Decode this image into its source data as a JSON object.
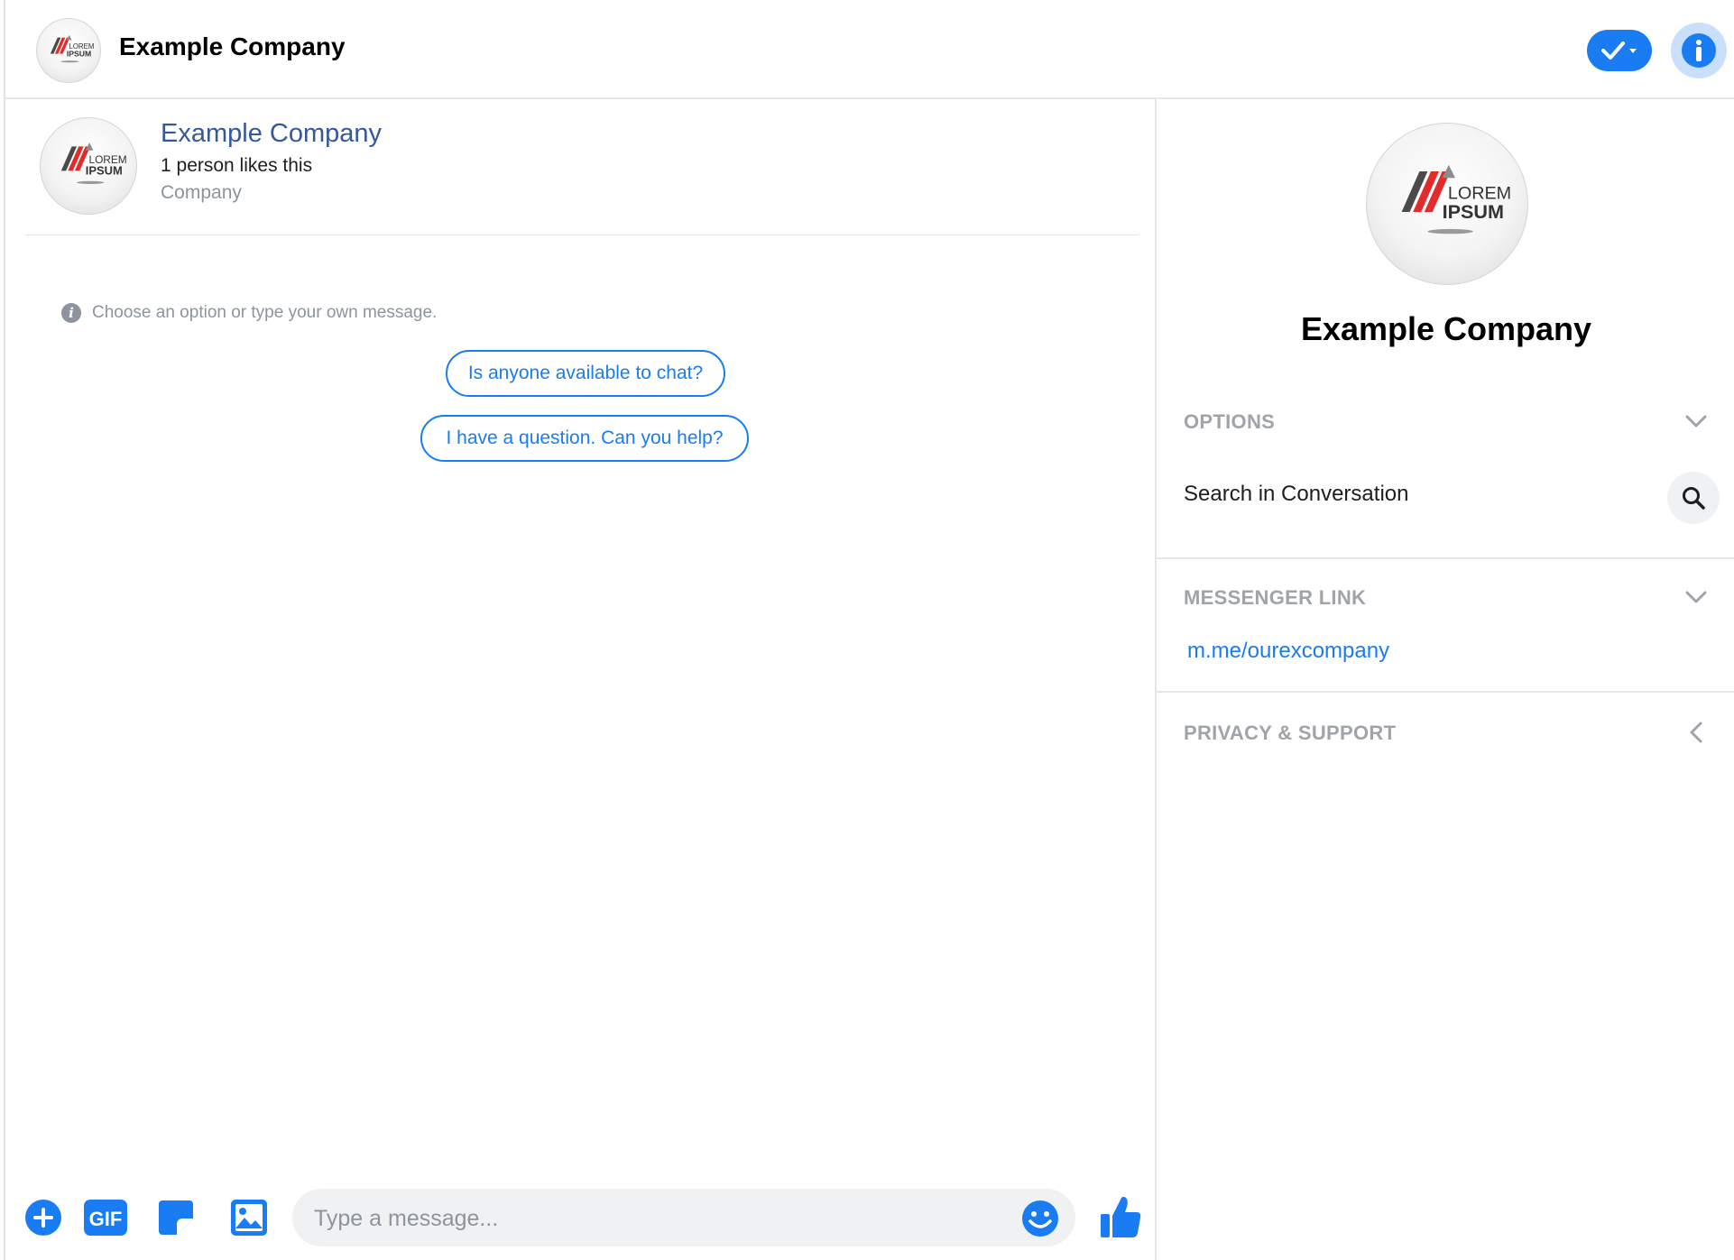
{
  "header": {
    "title": "Example Company"
  },
  "logo": {
    "line1": "LOREM",
    "line2": "IPSUM",
    "colors": {
      "dark": "#4a4a4a",
      "red": "#e32b2b",
      "gray": "#8c8c8c"
    }
  },
  "profile": {
    "name": "Example Company",
    "likes": "1 person likes this",
    "category": "Company"
  },
  "conversation": {
    "hint": "Choose an option or type your own message.",
    "quick_replies": [
      "Is anyone available to chat?",
      "I have a question. Can you help?"
    ]
  },
  "composer": {
    "icons": [
      "plus-icon",
      "gif-icon",
      "sticker-icon",
      "photo-icon",
      "emoji-icon",
      "thumbs-up-icon"
    ],
    "gif_label": "GIF",
    "placeholder": "Type a message..."
  },
  "sidebar": {
    "title": "Example Company",
    "sections": {
      "options": {
        "label": "OPTIONS",
        "search_label": "Search in Conversation"
      },
      "messenger_link": {
        "label": "MESSENGER LINK",
        "link": "m.me/ourexcompany"
      },
      "privacy": {
        "label": "PRIVACY & SUPPORT"
      }
    }
  },
  "colors": {
    "accent": "#1a7cf2",
    "profile_name": "#365899",
    "muted": "#8d949e",
    "section_heading": "#a0a4aa"
  }
}
